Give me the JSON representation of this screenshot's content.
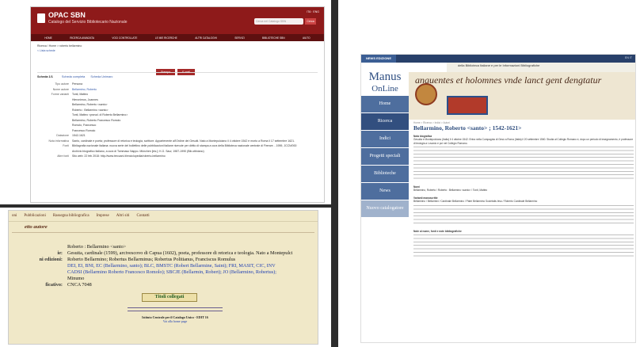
{
  "opac": {
    "title": "OPAC SBN",
    "subtitle": "Catalogo del Servizio Bibliotecario Nazionale",
    "lang": "ITA · ENG",
    "search_placeholder": "Cerca nel Catalogo SBN",
    "search_button": "Cerca",
    "nav": [
      "Home",
      "Ricerca avanzata",
      "Voci controllate",
      "Le mie ricerche",
      "Altri cataloghi",
      "Servizi",
      "Biblioteche SBN",
      "Aiuto"
    ],
    "breadcrumb": "Ricerca / Home > roberto bellarmino",
    "back_link": "< Lista schede",
    "buttons": [
      "Stampa",
      "E-mail"
    ],
    "scheda_label": "Scheda 1/1",
    "scheda_links": [
      "Scheda completa",
      "Scheda Unimarc"
    ],
    "fields": [
      {
        "label": "Tipo autore",
        "value": "Persona",
        "link": false
      },
      {
        "label": "Nome autore",
        "value": "Bellarmino, Roberto",
        "link": true
      },
      {
        "label": "Forme varianti",
        "value": "Tonti, Matteo",
        "link": false
      },
      {
        "label": "",
        "value": "Hieronimus, Joannes",
        "link": false
      },
      {
        "label": "",
        "value": "Bellarmino, Roberto <santo>",
        "link": false
      },
      {
        "label": "",
        "value": "Roberto : Bellarmino <santo>",
        "link": false
      },
      {
        "label": "",
        "value": "Tonti, Matteo <pseud. di Roberto Bellarmino>",
        "link": false
      },
      {
        "label": "",
        "value": "Bellarmino, Roberto Francesco Romolo",
        "link": false
      },
      {
        "label": "",
        "value": "Romolo, Francesco",
        "link": false
      },
      {
        "label": "",
        "value": "Francesco Romolo",
        "link": false
      },
      {
        "label": "Datazione",
        "value": "1542-1621",
        "link": false
      },
      {
        "label": "Nota informativa",
        "value": "Santo, cardinale e poeta; professore di retorica e teologia, scrittore. Appartenente all'Ordine dei Gesuiti. Nato a Montepulciano il 4 ottobre 1542 e morto a Roma il 17 settembre 1621.",
        "link": false
      },
      {
        "label": "Fonti",
        "value": "Bibliografia nazionale italiana: nuova serie del bollettino delle pubblicazioni italiane ricevute per diritto di stampa a cura della Biblioteca nazionale centrale di Firenze. - 1959, JCCN/000",
        "link": false
      },
      {
        "label": "",
        "value": "Archivio biografico italiano, a cura di Tommaso Nappo. München [etc.]: K.G. Saur, 1987-1990 (Bib.ottiniano)",
        "link": false
      },
      {
        "label": "Altre fonti",
        "value": "Sito web: 22 feb 2018: http://www.treccani.it/enciclopedia/roberto-bellarmino",
        "link": false
      }
    ]
  },
  "manus": {
    "top_tab": "NEWS EDIZIONE",
    "top_right": "EN  IT",
    "inst_text": "della Biblioteca Italiane e per le Informazioni Bibliografiche",
    "logo_line1": "Manus",
    "logo_line2": "OnLine",
    "banner_script": "anguentes et holomnes vnde lanct gent dengtatur",
    "sidebar": [
      "Home",
      "Ricerca",
      "Indici",
      "Progetti speciali",
      "Biblioteche",
      "News",
      "Nuovo catalogatore"
    ],
    "breadcrumb": "Home > Ricerca > Indici > Autori",
    "heading": "Bellarmino, Roberto <santo> ; 1542-1621>",
    "sec_bio": "Nota biografica",
    "bio_text": "Gesuita e Montepulciano (Italia) il 4 ottobre 1542. Entra nella Compagnia di Gesù a Roma (Italia) il 20 settembre 1560. Studia al Collegio Romano e, dopo un periodo di insegnamento, è professore di teologia a Lovanio e poi nel Collegio Romano.",
    "sec_names": "Nomi",
    "names_text": "Bellarmino, Roberto / Roberto : Bellarmino <santo> / Tonti, Matteo",
    "sec_variants": "Varianti manoscritte",
    "variants_text": "Bellarmino / Bellarmini / Cardinale Bellarmino / Pater Bellarmino Societatis Iesu / Roberto Cardinale Bellarmino",
    "sec_notes": "Note al nome, fonti e note bibliografiche"
  },
  "sbn": {
    "nav": [
      "oni",
      "Pubblicazioni",
      "Rassegna bibliografica",
      "Imprese",
      "Altri siti",
      "Contatti"
    ],
    "header": "etto autore",
    "rows": [
      {
        "label": "",
        "text": "Roberto : Bellarmino <santo>",
        "blue": false
      },
      {
        "label": "ie:",
        "text": "Gesuita, cardinale (1599), arcivescovo di Capua (1602), poeta, professore di retorica e teologia. Nato a Montepulci",
        "blue": false
      },
      {
        "label": "ni edizioni:",
        "text": "Roberto Bellarmino; Robertus Bellarminus; Robertus Politianus, Franciscus Romulus",
        "blue": false
      },
      {
        "label": "",
        "text": "DEI, EI, BNI, EC (Bellarmino, santo); BLC, BMSTC (Robert Bellarmine, Saint); FRI, MASIT, CIC, INV",
        "blue": true
      },
      {
        "label": "",
        "text": "CADSI (Bellarmino Roberto Francesco Romolo); SBCJE (Bellarmin, Robert); JO (Bellarmino, Robertus);",
        "blue": true
      },
      {
        "label": "",
        "text": "Minumo",
        "blue": false
      },
      {
        "label": "ficativo:",
        "text": "CNCA 7048",
        "blue": false
      }
    ],
    "titles_button": "Titoli collegati",
    "footer": "Istituto Centrale per il Catalogo Unico - EDIT 16",
    "footer_link": "Vai alla home page"
  }
}
